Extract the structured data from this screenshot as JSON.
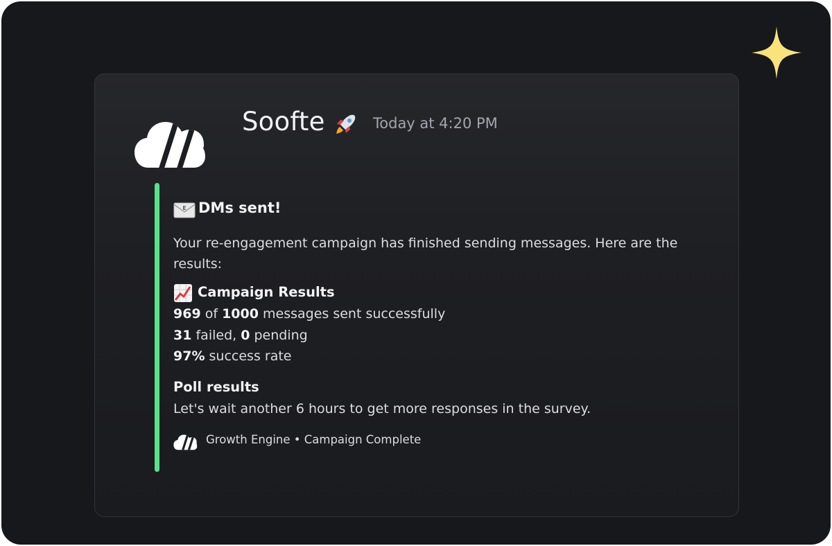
{
  "message": {
    "author": "Soofte",
    "author_emoji": "rocket-emoji",
    "timestamp": "Today at 4:20 PM",
    "accent_color": "#57e389"
  },
  "embed": {
    "title_emoji": "envelope-emoji",
    "title": "DMs sent!",
    "description": "Your re-engagement campaign has finished sending messages. Here are the results:",
    "campaign": {
      "emoji": "chart-increasing-emoji",
      "title": "Campaign Results",
      "sent": "969",
      "of_word": " of ",
      "total": "1000",
      "sent_suffix": " messages sent successfully",
      "failed": "31",
      "failed_mid": " failed, ",
      "pending": "0",
      "pending_suffix": " pending",
      "rate": "97%",
      "rate_suffix": " success rate"
    },
    "poll": {
      "title": "Poll results",
      "text": "Let's wait another 6 hours to get more responses in the survey."
    },
    "footer": {
      "text": "Growth Engine • Campaign Complete"
    }
  },
  "colors": {
    "background": "#17181b",
    "card": "#1e1f23",
    "text_primary": "#f2f3f5",
    "text_secondary": "#a3a6ad",
    "sparkle": "#f9e37a"
  }
}
